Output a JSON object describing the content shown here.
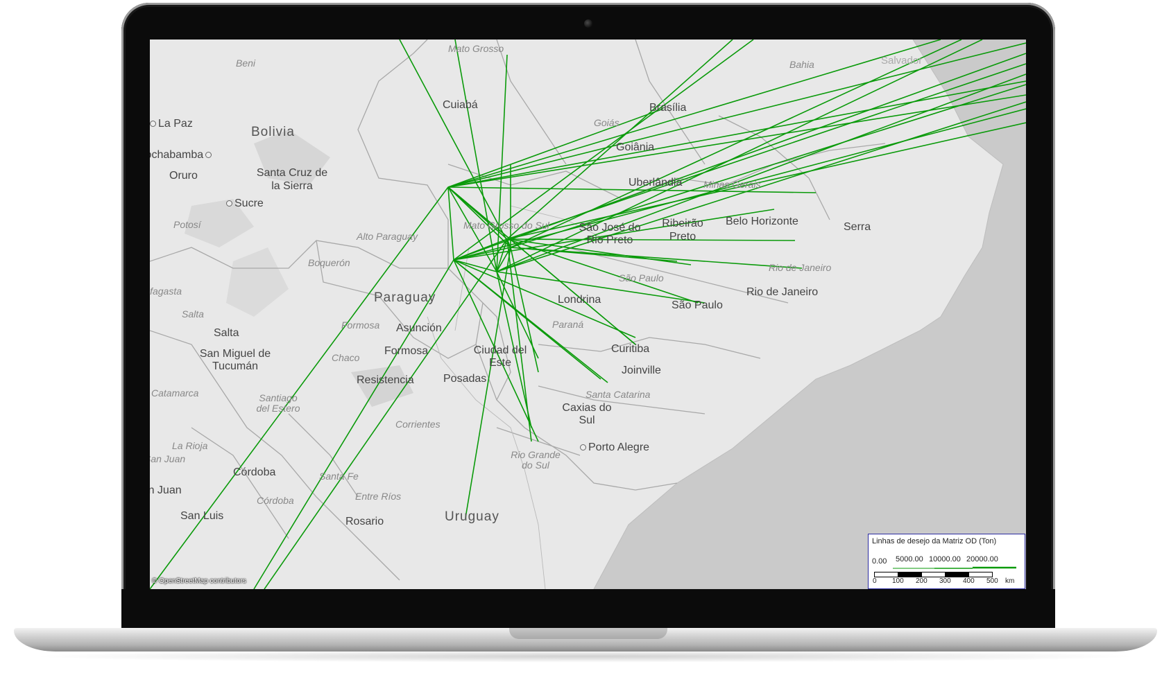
{
  "map": {
    "attribution": "© OpenStreetMap contributors",
    "line_color": "#0a9a0a",
    "cities": [
      {
        "name": "La Paz",
        "dot": true
      },
      {
        "name": "Cochabamba",
        "dot": true
      },
      {
        "name": "Oruro",
        "dot": false
      },
      {
        "name": "Sucre",
        "dot": true
      },
      {
        "name": "Santa Cruz de la Sierra",
        "dot": true
      },
      {
        "name": "Cuiabá",
        "dot": false
      },
      {
        "name": "Brasília",
        "dot": true
      },
      {
        "name": "Goiânia",
        "dot": false
      },
      {
        "name": "Uberlândia",
        "dot": false
      },
      {
        "name": "Ribeirão Preto",
        "dot": false
      },
      {
        "name": "Belo Horizonte",
        "dot": false
      },
      {
        "name": "Serra",
        "dot": false
      },
      {
        "name": "Salvador",
        "dot": false
      },
      {
        "name": "São José do Rio Preto",
        "dot": false
      },
      {
        "name": "São Paulo",
        "dot": false
      },
      {
        "name": "Rio de Janeiro",
        "dot": false
      },
      {
        "name": "Londrina",
        "dot": false
      },
      {
        "name": "Curitiba",
        "dot": false
      },
      {
        "name": "Joinville",
        "dot": false
      },
      {
        "name": "Asunción",
        "dot": true
      },
      {
        "name": "Formosa",
        "dot": false
      },
      {
        "name": "Resistencia",
        "dot": false
      },
      {
        "name": "Posadas",
        "dot": false
      },
      {
        "name": "Ciudad del Este",
        "dot": false
      },
      {
        "name": "Salta",
        "dot": false
      },
      {
        "name": "San Miguel de Tucumán",
        "dot": false
      },
      {
        "name": "Caxias do Sul",
        "dot": false
      },
      {
        "name": "Porto Alegre",
        "dot": true
      },
      {
        "name": "Córdoba",
        "dot": false
      },
      {
        "name": "Rosario",
        "dot": false
      },
      {
        "name": "San Luis",
        "dot": false
      },
      {
        "name": "San Juan",
        "dot": true
      }
    ],
    "countries": [
      "Bolivia",
      "Paraguay",
      "Uruguay"
    ],
    "regions": [
      "Beni",
      "Mato Grosso",
      "Potosí",
      "Alto Paraguay",
      "Boquerón",
      "Goiás",
      "Minas Gerais",
      "Bahia",
      "Mato Grosso do Sul",
      "São Paulo",
      "Rio de Janeiro",
      "Paraná",
      "Santa Catarina",
      "Rio Grande do Sul",
      "Formosa",
      "Chaco",
      "Salta",
      "Santiago del Estero",
      "Corrientes",
      "Entre Ríos",
      "Santa Fe",
      "Córdoba",
      "La Rioja",
      "Catamarca",
      "San Juan",
      "Antofagasta"
    ]
  },
  "legend": {
    "title": "Linhas de desejo da Matriz OD (Ton)",
    "zero": "0.00",
    "values": [
      "5000.00",
      "10000.00",
      "20000.00"
    ],
    "scale_ticks": [
      "0",
      "100",
      "200",
      "300",
      "400",
      "500"
    ],
    "scale_unit": "km"
  }
}
